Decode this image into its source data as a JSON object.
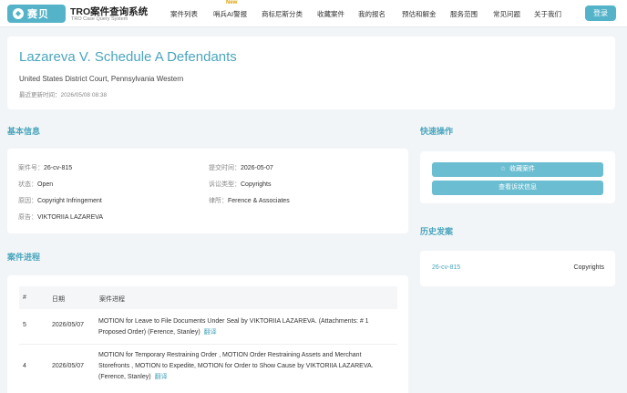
{
  "header": {
    "logo_text": "赛贝",
    "title": "TRO案件查询系统",
    "subtitle": "TRO Case Query System",
    "nav": [
      "案件列表",
      "哨兵AI警报",
      "商标尼斯分类",
      "收藏案件",
      "我的报名",
      "预估和解金",
      "服务范围",
      "常见问题",
      "关于我们"
    ],
    "new_badge": "New",
    "login": "登录"
  },
  "hero": {
    "title": "Lazareva V. Schedule A Defendants",
    "court": "United States District Court, Pennsylvania Western",
    "updated": "最近更新时间：2026/05/08 08:38"
  },
  "basic": {
    "section": "基本信息",
    "case_no_label": "案件号：",
    "case_no": "26-cv-815",
    "filed_label": "提交时间：",
    "filed": "2026-05-07",
    "status_label": "状态：",
    "status": "Open",
    "type_label": "诉讼类型：",
    "type": "Copyrights",
    "cause_label": "原因：",
    "cause": "Copyright Infringement",
    "firm_label": "律所：",
    "firm": "Ference & Associates",
    "plaintiff_label": "原告：",
    "plaintiff": "VIKTORIIA LAZAREVA"
  },
  "quick": {
    "section": "快速操作",
    "collect": "收藏案件",
    "view_docs": "查看诉状信息"
  },
  "history": {
    "section": "历史发案",
    "case": "26-cv-815",
    "type": "Copyrights"
  },
  "progress": {
    "section": "案件进程",
    "headers": [
      "#",
      "日期",
      "案件进程"
    ],
    "translate": "翻译",
    "rows": [
      {
        "num": "5",
        "date": "2026/05/07",
        "text": "MOTION for Leave to File Documents Under Seal by VIKTORIIA LAZAREVA. (Attachments: # 1 Proposed Order) (Ference, Stanley)"
      },
      {
        "num": "4",
        "date": "2026/05/07",
        "text": "MOTION for Temporary Restraining Order , MOTION Order Restraining Assets and Merchant Storefronts , MOTION to Expedite, MOTION for Order to Show Cause by VIKTORIIA LAZAREVA. (Ference, Stanley)"
      }
    ]
  },
  "colors": {
    "accent": "#55b3c9",
    "title": "#4aa5bd",
    "bg": "#f2f5f7"
  }
}
